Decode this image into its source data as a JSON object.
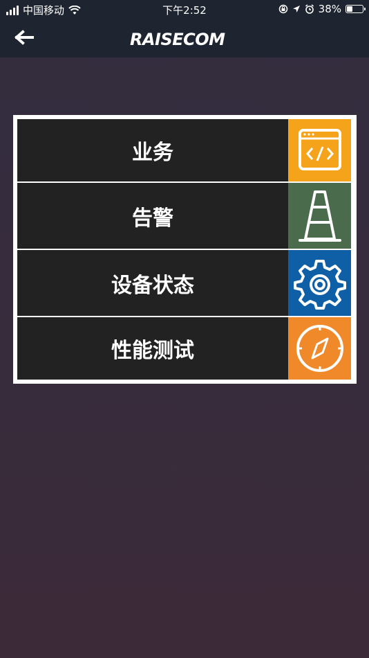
{
  "status_bar": {
    "carrier": "中国移动",
    "time": "下午2:52",
    "battery": "38%",
    "battery_level": 0.38
  },
  "header": {
    "back_icon": "arrow-left-icon",
    "logo_text": "RAISECOM"
  },
  "menu": {
    "items": [
      {
        "label": "业务",
        "icon": "code-window-icon",
        "color": "#f5a31a"
      },
      {
        "label": "告警",
        "icon": "traffic-cone-icon",
        "color": "#4a6b4c"
      },
      {
        "label": "设备状态",
        "icon": "gear-icon",
        "color": "#0f5fa6"
      },
      {
        "label": "性能测试",
        "icon": "compass-icon",
        "color": "#f0892a"
      }
    ]
  }
}
